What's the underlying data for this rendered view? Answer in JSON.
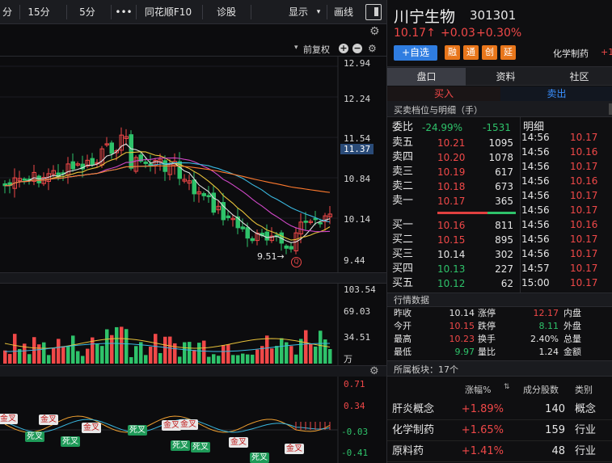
{
  "toolbar": {
    "items": [
      "分",
      "15分",
      "5分",
      "•••",
      "同花顺F10",
      "诊股",
      "显示",
      "画线"
    ]
  },
  "chart_header": {
    "mode": "前复权"
  },
  "price_axis": [
    "12.94",
    "12.24",
    "11.54",
    "11.37",
    "10.84",
    "10.14",
    "9.44"
  ],
  "volume_axis": [
    "103.54",
    "69.03",
    "34.51",
    "万"
  ],
  "macd_axis": [
    "0.71",
    "0.34",
    "-0.03",
    "-0.41"
  ],
  "low_marker": "9.51→",
  "cross_labels": {
    "gold": "金叉",
    "death": "死叉"
  },
  "stock": {
    "name": "川宁生物",
    "code": "301301",
    "price": "10.17↑",
    "change": "+0.03",
    "pct": "+0.30%",
    "add_label": "+自选",
    "tags": [
      "融",
      "通",
      "创",
      "延"
    ],
    "sector": "化学制药",
    "sector_pct": "+1"
  },
  "tabs": [
    "盘口",
    "资料",
    "社区"
  ],
  "buy_sell": {
    "buy": "买入",
    "sell": "卖出"
  },
  "orderbook_title": "买卖档位与明细（手）",
  "weibi": {
    "label": "委比",
    "pct": "-24.99%",
    "diff": "-1531"
  },
  "detail_label": "明细",
  "asks": [
    {
      "label": "卖五",
      "price": "10.21",
      "vol": "1095"
    },
    {
      "label": "卖四",
      "price": "10.20",
      "vol": "1078"
    },
    {
      "label": "卖三",
      "price": "10.19",
      "vol": "617"
    },
    {
      "label": "卖二",
      "price": "10.18",
      "vol": "673"
    },
    {
      "label": "卖一",
      "price": "10.17",
      "vol": "365"
    }
  ],
  "bids": [
    {
      "label": "买一",
      "price": "10.16",
      "vol": "811"
    },
    {
      "label": "买二",
      "price": "10.15",
      "vol": "895"
    },
    {
      "label": "买三",
      "price": "10.14",
      "vol": "302"
    },
    {
      "label": "买四",
      "price": "10.13",
      "vol": "227"
    },
    {
      "label": "买五",
      "price": "10.12",
      "vol": "62"
    }
  ],
  "ticks": [
    {
      "time": "14:56",
      "price": "10.17"
    },
    {
      "time": "14:56",
      "price": "10.16"
    },
    {
      "time": "14:56",
      "price": "10.17"
    },
    {
      "time": "14:56",
      "price": "10.16"
    },
    {
      "time": "14:56",
      "price": "10.17"
    },
    {
      "time": "14:56",
      "price": "10.17"
    },
    {
      "time": "14:56",
      "price": "10.16"
    },
    {
      "time": "14:56",
      "price": "10.17"
    },
    {
      "time": "14:56",
      "price": "10.17"
    },
    {
      "time": "14:57",
      "price": "10.17"
    },
    {
      "time": "15:00",
      "price": "10.17"
    }
  ],
  "market_title": "行情数据",
  "market": [
    {
      "l1": "昨收",
      "v1": "10.14",
      "l2": "涨停",
      "v2": "12.17",
      "l3": "内盘"
    },
    {
      "l1": "今开",
      "v1": "10.15",
      "l2": "跌停",
      "v2": "8.11",
      "l3": "外盘"
    },
    {
      "l1": "最高",
      "v1": "10.23",
      "l2": "换手",
      "v2": "2.40%",
      "l3": "总量"
    },
    {
      "l1": "最低",
      "v1": "9.97",
      "l2": "量比",
      "v2": "1.24",
      "l3": "金额"
    }
  ],
  "sector_title": "所属板块：17个",
  "sector_headers": [
    "",
    "涨幅%",
    "成分股数",
    "类别"
  ],
  "sectors": [
    {
      "name": "肝炎概念",
      "pct": "+1.89%",
      "count": "140",
      "type": "概念"
    },
    {
      "name": "化学制药",
      "pct": "+1.65%",
      "count": "159",
      "type": "行业"
    },
    {
      "name": "原料药",
      "pct": "+1.41%",
      "count": "48",
      "type": "行业"
    }
  ]
}
